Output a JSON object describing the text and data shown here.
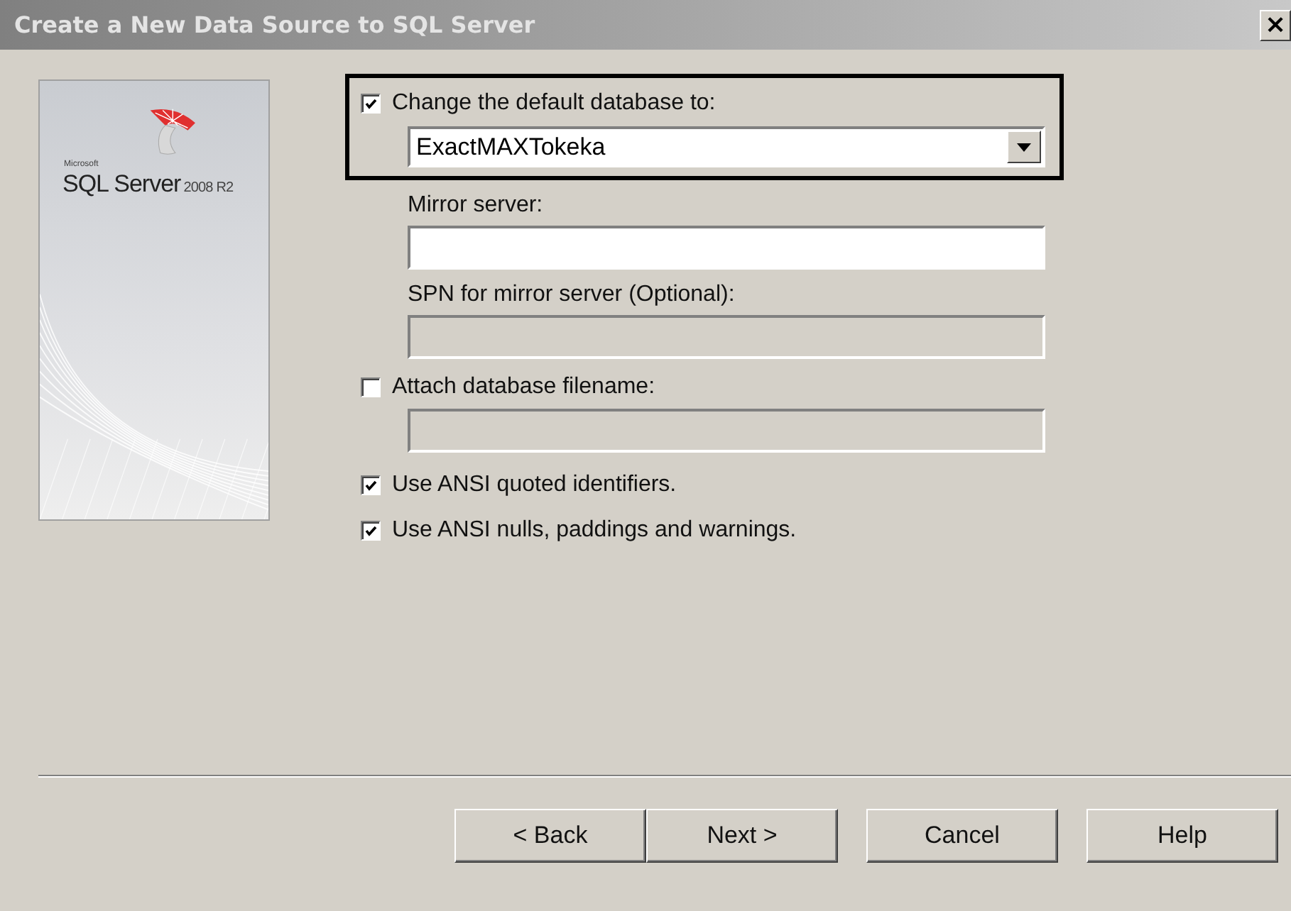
{
  "window": {
    "title": "Create a New Data Source to SQL Server",
    "close": "×"
  },
  "logo": {
    "brand": "Microsoft",
    "product": "SQL Server",
    "version": "2008 R2"
  },
  "default_database": {
    "label": "Change the default database to:",
    "checked": true,
    "highlighted": true,
    "value": "ExactMAXTokeka"
  },
  "mirror_server": {
    "label": "Mirror server:",
    "disabled": false
  },
  "spn": {
    "label": "SPN for mirror server (Optional):",
    "disabled": true
  },
  "attach": {
    "label": "Attach database filename:",
    "checked": false,
    "disabled": true
  },
  "ansi_options": [
    {
      "label": "Use ANSI quoted identifiers.",
      "checked": true
    },
    {
      "label": "Use ANSI nulls, paddings and warnings.",
      "checked": true
    }
  ],
  "button_groups": [
    [
      "< Back",
      "Next >"
    ],
    [
      "Cancel"
    ],
    [
      "Help"
    ]
  ]
}
